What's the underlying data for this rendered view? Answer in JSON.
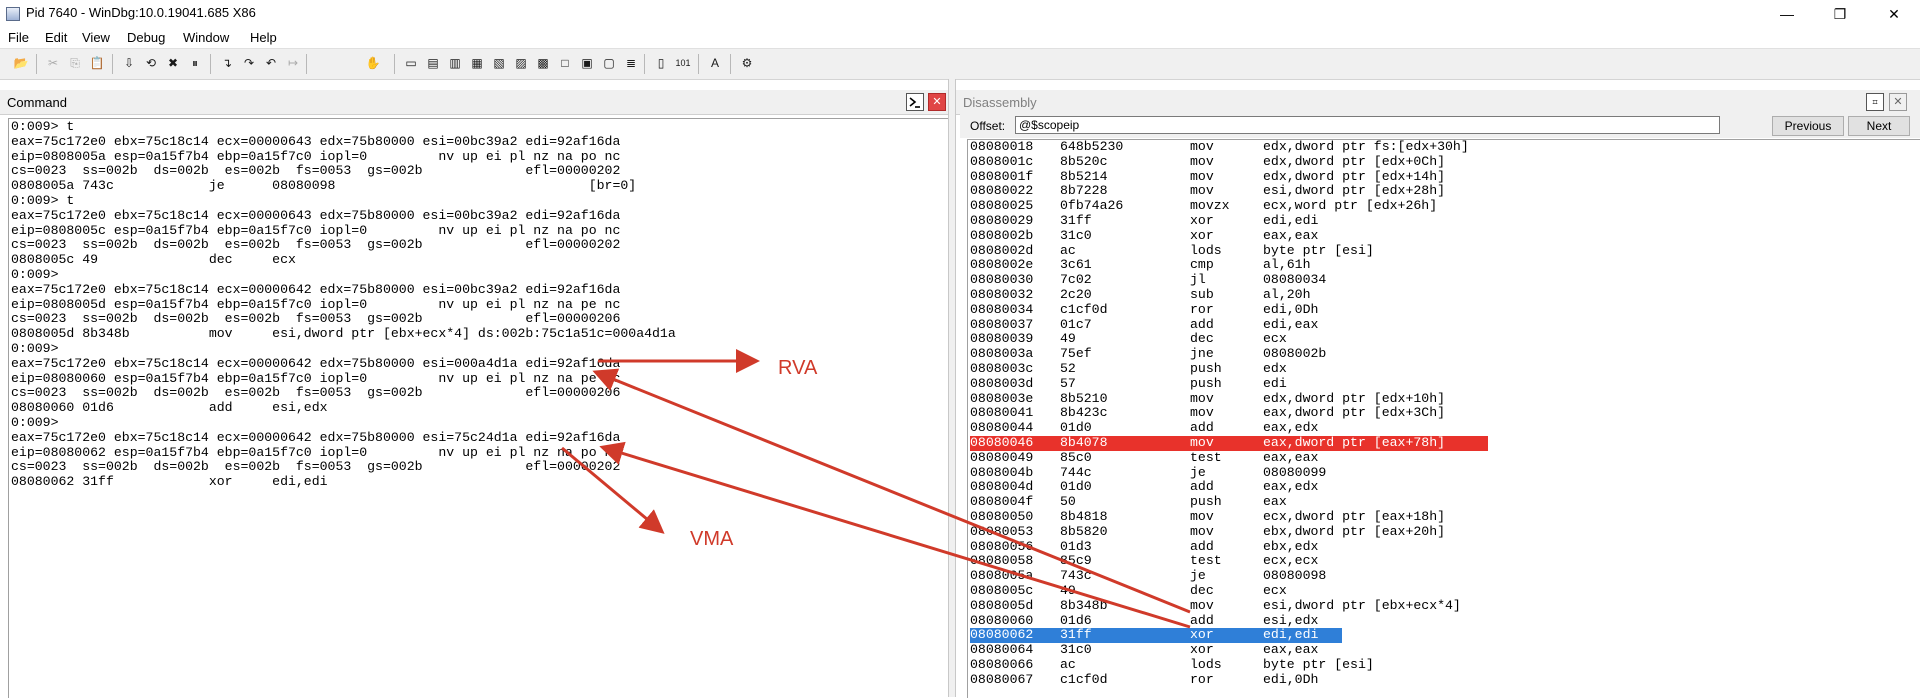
{
  "window": {
    "title": "Pid 7640 - WinDbg:10.0.19041.685 X86",
    "minimize": "—",
    "restore": "❐",
    "close": "✕"
  },
  "menu": [
    "File",
    "Edit",
    "View",
    "Debug",
    "Window",
    "Help"
  ],
  "command_pane": {
    "title": "Command",
    "lines": [
      "0:009> t",
      "eax=75c172e0 ebx=75c18c14 ecx=00000643 edx=75b80000 esi=00bc39a2 edi=92af16da",
      "eip=0808005a esp=0a15f7b4 ebp=0a15f7c0 iopl=0         nv up ei pl nz na po nc",
      "cs=0023  ss=002b  ds=002b  es=002b  fs=0053  gs=002b             efl=00000202",
      "0808005a 743c            je      08080098                                [br=0]",
      "0:009> t",
      "eax=75c172e0 ebx=75c18c14 ecx=00000643 edx=75b80000 esi=00bc39a2 edi=92af16da",
      "eip=0808005c esp=0a15f7b4 ebp=0a15f7c0 iopl=0         nv up ei pl nz na po nc",
      "cs=0023  ss=002b  ds=002b  es=002b  fs=0053  gs=002b             efl=00000202",
      "0808005c 49              dec     ecx",
      "0:009>",
      "eax=75c172e0 ebx=75c18c14 ecx=00000642 edx=75b80000 esi=00bc39a2 edi=92af16da",
      "eip=0808005d esp=0a15f7b4 ebp=0a15f7c0 iopl=0         nv up ei pl nz na pe nc",
      "cs=0023  ss=002b  ds=002b  es=002b  fs=0053  gs=002b             efl=00000206",
      "0808005d 8b348b          mov     esi,dword ptr [ebx+ecx*4] ds:002b:75c1a51c=000a4d1a",
      "0:009>",
      "eax=75c172e0 ebx=75c18c14 ecx=00000642 edx=75b80000 esi=000a4d1a edi=92af16da",
      "eip=08080060 esp=0a15f7b4 ebp=0a15f7c0 iopl=0         nv up ei pl nz na pe nc",
      "cs=0023  ss=002b  ds=002b  es=002b  fs=0053  gs=002b             efl=00000206",
      "08080060 01d6            add     esi,edx",
      "0:009>",
      "eax=75c172e0 ebx=75c18c14 ecx=00000642 edx=75b80000 esi=75c24d1a edi=92af16da",
      "eip=08080062 esp=0a15f7b4 ebp=0a15f7c0 iopl=0         nv up ei pl nz na po nc",
      "cs=0023  ss=002b  ds=002b  es=002b  fs=0053  gs=002b             efl=00000202",
      "08080062 31ff            xor     edi,edi"
    ]
  },
  "disassembly_pane": {
    "title": "Disassembly",
    "offset_label": "Offset:",
    "offset_value": "@$scopeip",
    "previous_label": "Previous",
    "next_label": "Next",
    "highlight_red_color": "#e8322b",
    "highlight_blue_color": "#2f7fd8",
    "lines": [
      {
        "addr": "08080018",
        "bytes": "648b5230",
        "mn": "mov",
        "ops": "edx,dword ptr fs:[edx+30h]",
        "hl": ""
      },
      {
        "addr": "0808001c",
        "bytes": "8b520c",
        "mn": "mov",
        "ops": "edx,dword ptr [edx+0Ch]",
        "hl": ""
      },
      {
        "addr": "0808001f",
        "bytes": "8b5214",
        "mn": "mov",
        "ops": "edx,dword ptr [edx+14h]",
        "hl": ""
      },
      {
        "addr": "08080022",
        "bytes": "8b7228",
        "mn": "mov",
        "ops": "esi,dword ptr [edx+28h]",
        "hl": ""
      },
      {
        "addr": "08080025",
        "bytes": "0fb74a26",
        "mn": "movzx",
        "ops": "ecx,word ptr [edx+26h]",
        "hl": ""
      },
      {
        "addr": "08080029",
        "bytes": "31ff",
        "mn": "xor",
        "ops": "edi,edi",
        "hl": ""
      },
      {
        "addr": "0808002b",
        "bytes": "31c0",
        "mn": "xor",
        "ops": "eax,eax",
        "hl": ""
      },
      {
        "addr": "0808002d",
        "bytes": "ac",
        "mn": "lods",
        "ops": "byte ptr [esi]",
        "hl": ""
      },
      {
        "addr": "0808002e",
        "bytes": "3c61",
        "mn": "cmp",
        "ops": "al,61h",
        "hl": ""
      },
      {
        "addr": "08080030",
        "bytes": "7c02",
        "mn": "jl",
        "ops": "08080034",
        "hl": ""
      },
      {
        "addr": "08080032",
        "bytes": "2c20",
        "mn": "sub",
        "ops": "al,20h",
        "hl": ""
      },
      {
        "addr": "08080034",
        "bytes": "c1cf0d",
        "mn": "ror",
        "ops": "edi,0Dh",
        "hl": ""
      },
      {
        "addr": "08080037",
        "bytes": "01c7",
        "mn": "add",
        "ops": "edi,eax",
        "hl": ""
      },
      {
        "addr": "08080039",
        "bytes": "49",
        "mn": "dec",
        "ops": "ecx",
        "hl": ""
      },
      {
        "addr": "0808003a",
        "bytes": "75ef",
        "mn": "jne",
        "ops": "0808002b",
        "hl": ""
      },
      {
        "addr": "0808003c",
        "bytes": "52",
        "mn": "push",
        "ops": "edx",
        "hl": ""
      },
      {
        "addr": "0808003d",
        "bytes": "57",
        "mn": "push",
        "ops": "edi",
        "hl": ""
      },
      {
        "addr": "0808003e",
        "bytes": "8b5210",
        "mn": "mov",
        "ops": "edx,dword ptr [edx+10h]",
        "hl": ""
      },
      {
        "addr": "08080041",
        "bytes": "8b423c",
        "mn": "mov",
        "ops": "eax,dword ptr [edx+3Ch]",
        "hl": ""
      },
      {
        "addr": "08080044",
        "bytes": "01d0",
        "mn": "add",
        "ops": "eax,edx",
        "hl": ""
      },
      {
        "addr": "08080046",
        "bytes": "8b4078",
        "mn": "mov",
        "ops": "eax,dword ptr [eax+78h]",
        "hl": "red"
      },
      {
        "addr": "08080049",
        "bytes": "85c0",
        "mn": "test",
        "ops": "eax,eax",
        "hl": ""
      },
      {
        "addr": "0808004b",
        "bytes": "744c",
        "mn": "je",
        "ops": "08080099",
        "hl": ""
      },
      {
        "addr": "0808004d",
        "bytes": "01d0",
        "mn": "add",
        "ops": "eax,edx",
        "hl": ""
      },
      {
        "addr": "0808004f",
        "bytes": "50",
        "mn": "push",
        "ops": "eax",
        "hl": ""
      },
      {
        "addr": "08080050",
        "bytes": "8b4818",
        "mn": "mov",
        "ops": "ecx,dword ptr [eax+18h]",
        "hl": ""
      },
      {
        "addr": "08080053",
        "bytes": "8b5820",
        "mn": "mov",
        "ops": "ebx,dword ptr [eax+20h]",
        "hl": ""
      },
      {
        "addr": "08080056",
        "bytes": "01d3",
        "mn": "add",
        "ops": "ebx,edx",
        "hl": ""
      },
      {
        "addr": "08080058",
        "bytes": "85c9",
        "mn": "test",
        "ops": "ecx,ecx",
        "hl": ""
      },
      {
        "addr": "0808005a",
        "bytes": "743c",
        "mn": "je",
        "ops": "08080098",
        "hl": ""
      },
      {
        "addr": "0808005c",
        "bytes": "49",
        "mn": "dec",
        "ops": "ecx",
        "hl": ""
      },
      {
        "addr": "0808005d",
        "bytes": "8b348b",
        "mn": "mov",
        "ops": "esi,dword ptr [ebx+ecx*4]",
        "hl": ""
      },
      {
        "addr": "08080060",
        "bytes": "01d6",
        "mn": "add",
        "ops": "esi,edx",
        "hl": ""
      },
      {
        "addr": "08080062",
        "bytes": "31ff",
        "mn": "xor",
        "ops": "edi,edi",
        "hl": "blue"
      },
      {
        "addr": "08080064",
        "bytes": "31c0",
        "mn": "xor",
        "ops": "eax,eax",
        "hl": ""
      },
      {
        "addr": "08080066",
        "bytes": "ac",
        "mn": "lods",
        "ops": "byte ptr [esi]",
        "hl": ""
      },
      {
        "addr": "08080067",
        "bytes": "c1cf0d",
        "mn": "ror",
        "ops": "edi,0Dh",
        "hl": ""
      }
    ]
  },
  "annotations": {
    "rva_label": "RVA",
    "vma_label": "VMA",
    "arrow_color": "#d03a2a"
  }
}
